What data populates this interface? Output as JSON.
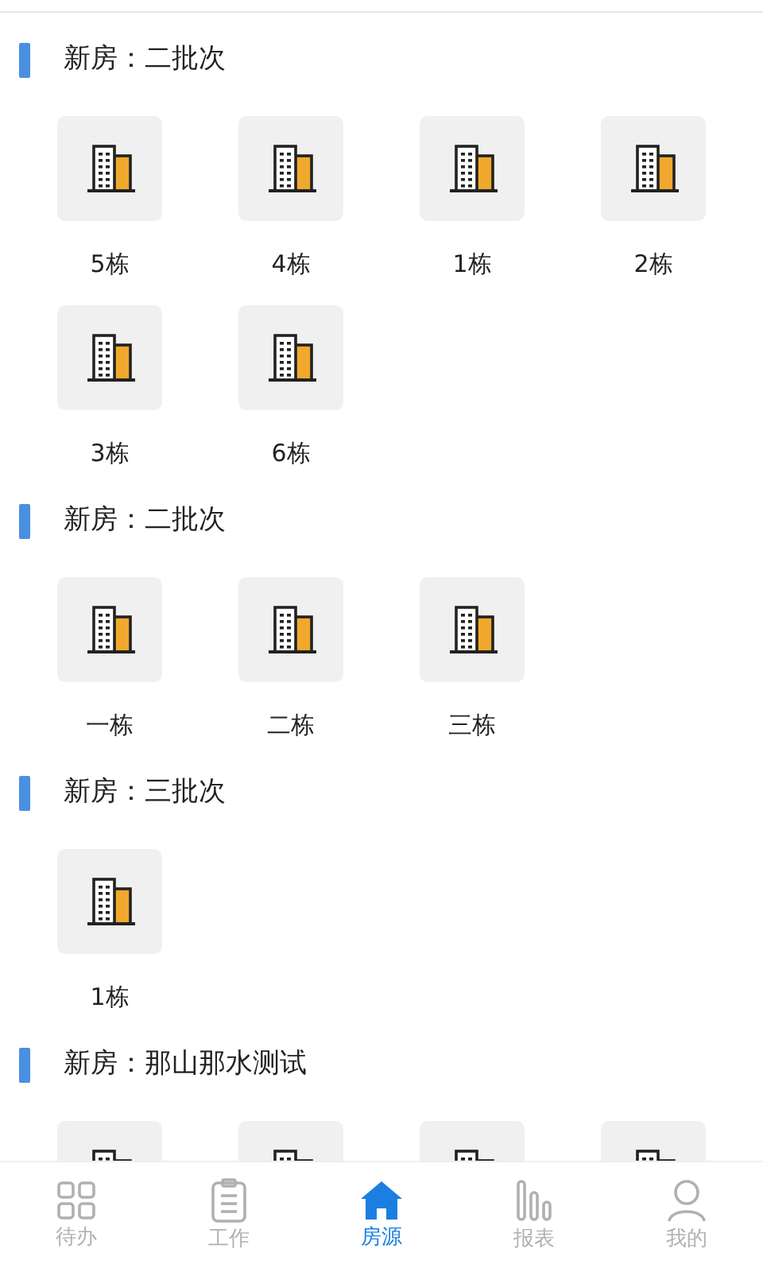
{
  "sections": [
    {
      "title": "新房：二批次",
      "buildings": [
        {
          "kind": "building",
          "label": "5栋"
        },
        {
          "kind": "building",
          "label": "4栋"
        },
        {
          "kind": "building",
          "label": "1栋"
        },
        {
          "kind": "building",
          "label": "2栋"
        },
        {
          "kind": "building",
          "label": "3栋"
        },
        {
          "kind": "building",
          "label": "6栋"
        }
      ]
    },
    {
      "title": "新房：二批次",
      "buildings": [
        {
          "kind": "building",
          "label": "一栋"
        },
        {
          "kind": "building",
          "label": "二栋"
        },
        {
          "kind": "building",
          "label": "三栋"
        }
      ]
    },
    {
      "title": "新房：三批次",
      "buildings": [
        {
          "kind": "building",
          "label": "1栋"
        }
      ]
    },
    {
      "title": "新房：那山那水测试",
      "buildings": [
        {
          "kind": "building"
        },
        {
          "kind": "building"
        },
        {
          "kind": "building"
        },
        {
          "kind": "building"
        }
      ]
    }
  ],
  "tab_bar": [
    {
      "kind": "grid",
      "label": "待办",
      "selected": false
    },
    {
      "kind": "clipboard",
      "label": "工作",
      "selected": false
    },
    {
      "kind": "house",
      "label": "房源",
      "selected": true
    },
    {
      "kind": "chart",
      "label": "报表",
      "selected": false
    },
    {
      "kind": "person",
      "label": "我的",
      "selected": false
    }
  ]
}
